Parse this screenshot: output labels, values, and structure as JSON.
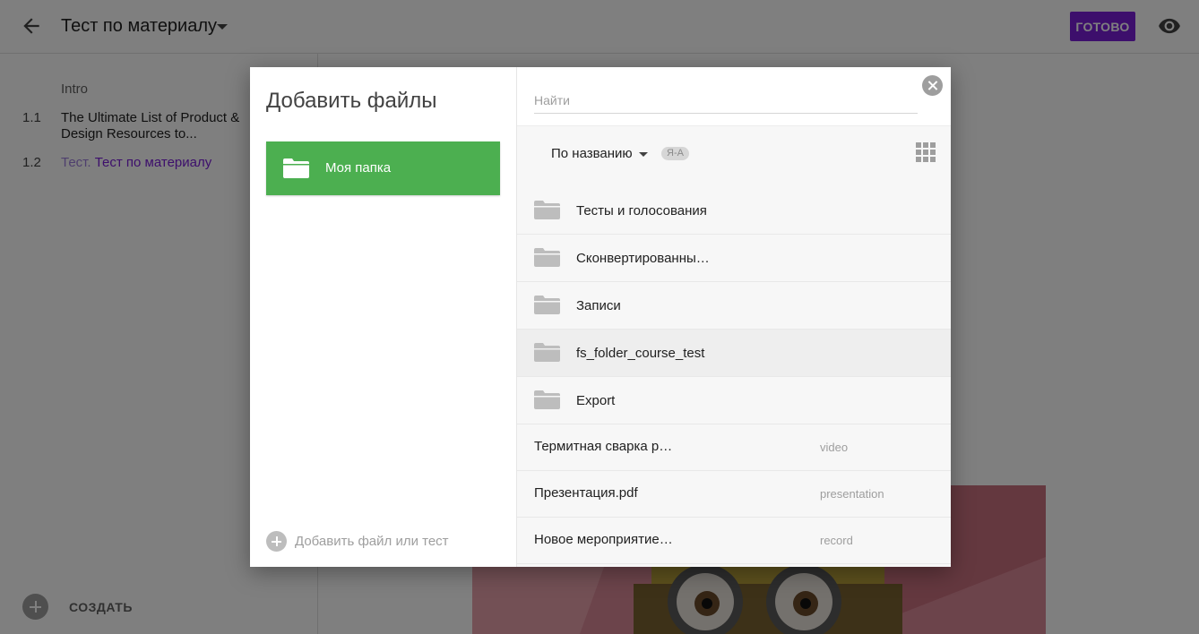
{
  "header": {
    "course_title": "Тест по материалу",
    "done_label": "ГОТОВО"
  },
  "sidebar": {
    "section_label": "Intro",
    "lessons": [
      {
        "number": "1.1",
        "title": "The Ultimate List of Product & Design Resources to..."
      },
      {
        "number": "1.2",
        "prefix": "Тест.",
        "title": "Тест по материалу"
      }
    ],
    "create_label": "СОЗДАТЬ"
  },
  "modal": {
    "title": "Добавить файлы",
    "my_folder_label": "Моя папка",
    "add_file_label": "Добавить файл или тест",
    "search_placeholder": "Найти",
    "sort_label": "По названию",
    "sort_badge": "Я-А",
    "folders": [
      {
        "name": "Тесты и голосования"
      },
      {
        "name": "Сконвертированны…"
      },
      {
        "name": "Записи"
      },
      {
        "name": "fs_folder_course_test"
      },
      {
        "name": "Export"
      }
    ],
    "files": [
      {
        "name": "Термитная сварка р…",
        "type": "video"
      },
      {
        "name": "Презентация.pdf",
        "type": "presentation"
      },
      {
        "name": "Новое мероприятие…",
        "type": "record"
      }
    ]
  },
  "icons": {
    "back": "arrow-left-icon",
    "preview": "eye-icon",
    "close": "close-icon",
    "grid": "grid-view-icon",
    "folder": "folder-icon"
  },
  "colors": {
    "accent": "#7b1fd8",
    "folder_green": "#4caf50",
    "folder_grey": "#bdbdbd"
  }
}
